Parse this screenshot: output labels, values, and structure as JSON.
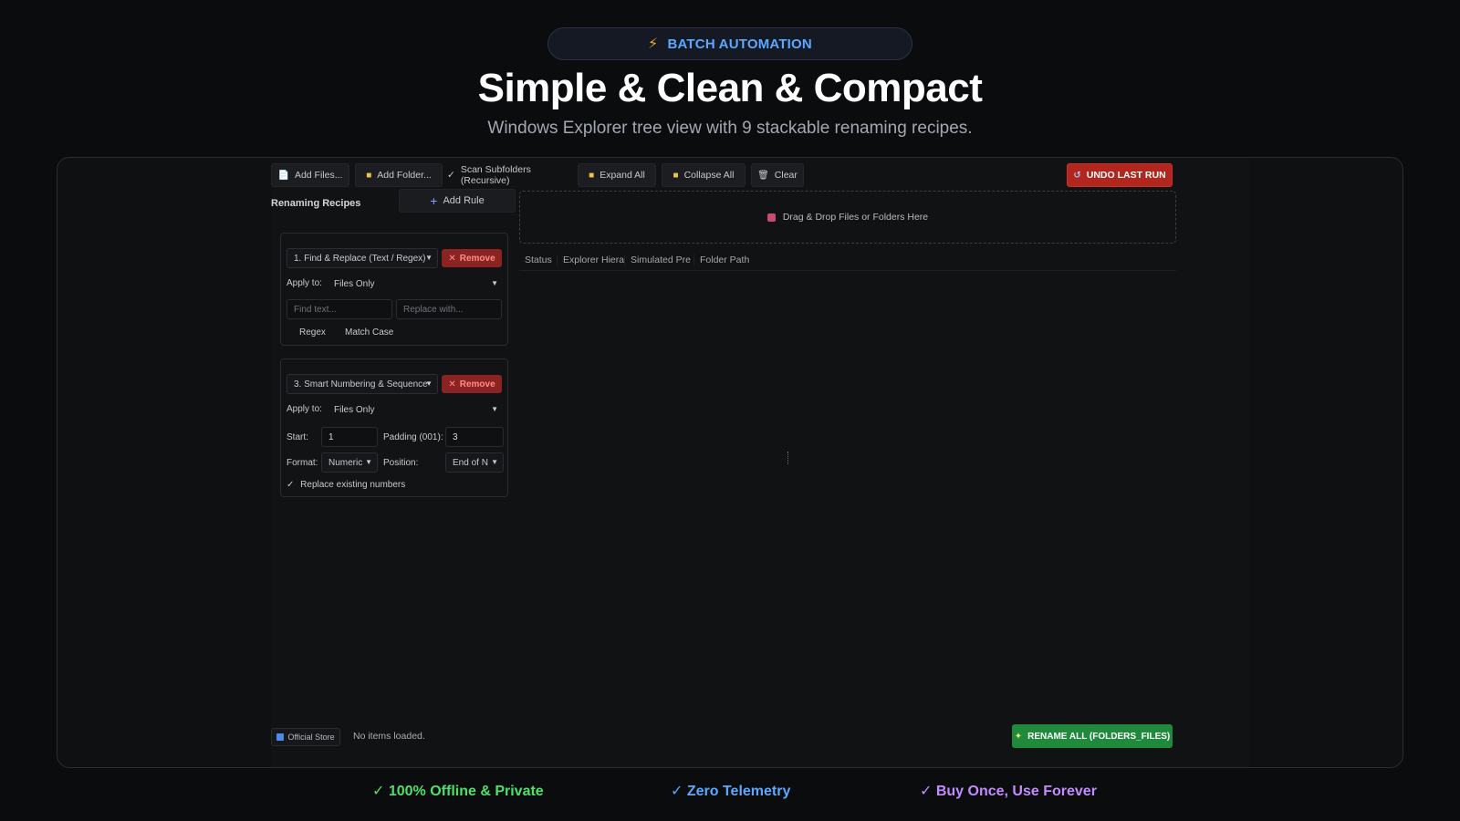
{
  "hero": {
    "badge": "BATCH AUTOMATION",
    "title": "Simple & Clean & Compact",
    "subtitle": "Windows Explorer tree view with 9 stackable renaming recipes."
  },
  "toolbar": {
    "add_files": "Add Files...",
    "add_folder": "Add Folder...",
    "scan_subfolders": "Scan Subfolders (Recursive)",
    "scan_checked": "✓",
    "expand_all": "Expand All",
    "collapse_all": "Collapse All",
    "clear": "Clear",
    "undo": "UNDO LAST RUN"
  },
  "recipes": {
    "section_label": "Renaming Recipes",
    "add_rule": "Add Rule",
    "rule1": {
      "type": "1. Find & Replace (Text / Regex)",
      "remove": "Remove",
      "apply_label": "Apply to:",
      "apply_value": "Files Only",
      "find_placeholder": "Find text...",
      "replace_placeholder": "Replace with...",
      "regex": "Regex",
      "match_case": "Match Case"
    },
    "rule2": {
      "type": "3. Smart Numbering & Sequence",
      "remove": "Remove",
      "apply_label": "Apply to:",
      "apply_value": "Files Only",
      "start_label": "Start:",
      "start_value": "1",
      "padding_label": "Padding (001):",
      "padding_value": "3",
      "format_label": "Format:",
      "format_value": "Numeric",
      "position_label": "Position:",
      "position_value": "End of N",
      "replace_existing": "Replace existing numbers",
      "replace_checked": "✓"
    }
  },
  "dropzone": {
    "text": "Drag & Drop Files or Folders Here"
  },
  "tree": {
    "columns": [
      "Status",
      "Explorer Hiera",
      "Simulated Pre",
      "Folder Path"
    ]
  },
  "footer": {
    "store": "Official Store",
    "status": "No items loaded.",
    "rename_all": "RENAME ALL (FOLDERS_FILES)"
  },
  "features": [
    {
      "text": "✓ 100% Offline & Private",
      "color": "#4ee06a"
    },
    {
      "text": "✓ Zero Telemetry",
      "color": "#5ca8ff"
    },
    {
      "text": "✓ Buy Once, Use Forever",
      "color": "#c48bff"
    }
  ]
}
